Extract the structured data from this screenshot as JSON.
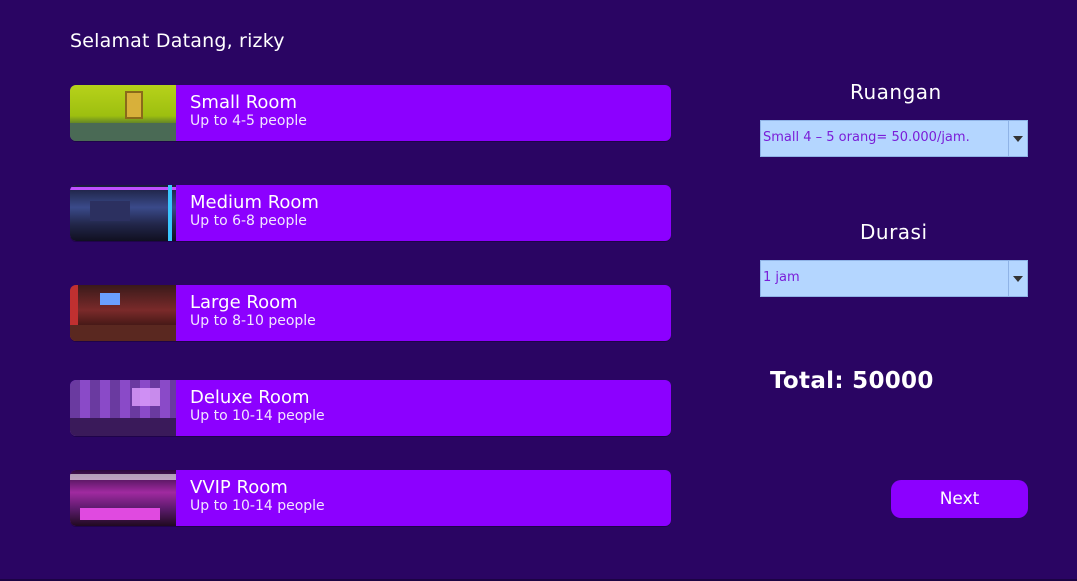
{
  "welcome": "Selamat Datang, rizky",
  "rooms": [
    {
      "name": "Small Room",
      "capacity": "Up to 4-5 people"
    },
    {
      "name": "Medium Room",
      "capacity": "Up to 6-8 people"
    },
    {
      "name": "Large Room",
      "capacity": "Up to 8-10 people"
    },
    {
      "name": "Deluxe Room",
      "capacity": "Up to 10-14 people"
    },
    {
      "name": "VVIP Room",
      "capacity": "Up to 10-14 people"
    }
  ],
  "form": {
    "ruangan_label": "Ruangan",
    "ruangan_value": "Small 4 – 5 orang= 50.000/jam.",
    "durasi_label": "Durasi",
    "durasi_value": "1 jam",
    "total": "Total: 50000",
    "next_label": "Next"
  },
  "colors": {
    "background": "#2a0563",
    "card": "#8c00ff",
    "select_bg": "#b4d6ff",
    "select_text": "#7a1ed8"
  }
}
